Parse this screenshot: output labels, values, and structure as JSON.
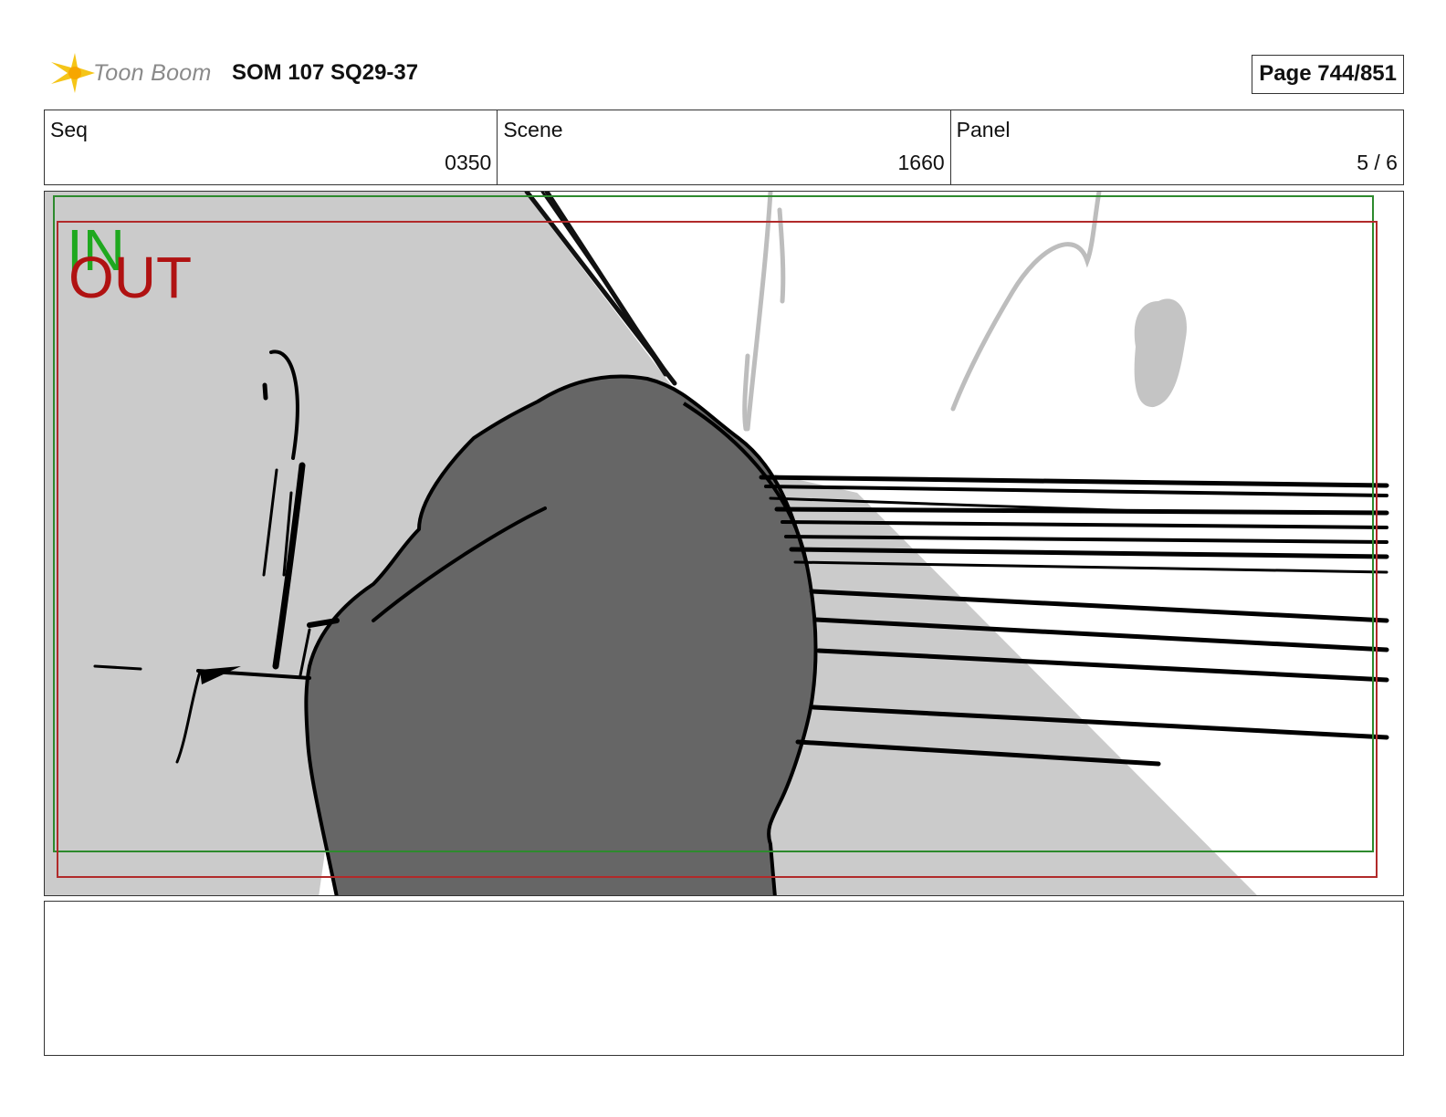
{
  "header": {
    "logo_name": "Toon Boom",
    "title": "SOM 107 SQ29-37",
    "page_indicator": "Page 744/851"
  },
  "info": {
    "seq_label": "Seq",
    "seq_value": "0350",
    "scene_label": "Scene",
    "scene_value": "1660",
    "panel_label": "Panel",
    "panel_value": "5 / 6"
  },
  "panel_image": {
    "in_marker": "IN",
    "out_marker": "OUT",
    "in_color": "#1fa81f",
    "out_color": "#b01212"
  },
  "notes": {
    "text": ""
  }
}
